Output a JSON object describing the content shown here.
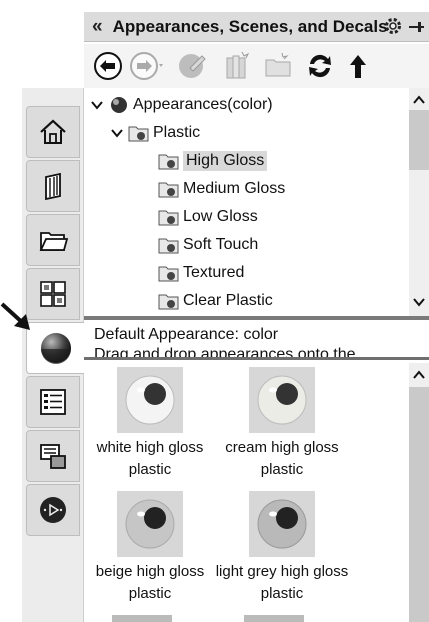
{
  "header": {
    "title": "Appearances, Scenes, and Decals"
  },
  "tree": {
    "root_label": "Appearances(color)",
    "category_label": "Plastic",
    "items": [
      {
        "label": "High Gloss",
        "selected": true
      },
      {
        "label": "Medium Gloss",
        "selected": false
      },
      {
        "label": "Low Gloss",
        "selected": false
      },
      {
        "label": "Soft Touch",
        "selected": false
      },
      {
        "label": "Textured",
        "selected": false
      },
      {
        "label": "Clear Plastic",
        "selected": false
      }
    ]
  },
  "info": {
    "line1": "Default Appearance: color",
    "line2": "Drag and drop appearances onto the"
  },
  "thumbnails": [
    {
      "label": "white high gloss plastic",
      "color": "#f2f2f2"
    },
    {
      "label": "cream high gloss plastic",
      "color": "#e8e8e2"
    },
    {
      "label": "beige high gloss plastic",
      "color": "#c4c4c4"
    },
    {
      "label": "light grey high gloss plastic",
      "color": "#b8b8b8"
    }
  ],
  "rail_tabs": [
    "home-icon",
    "design-library-icon",
    "file-explorer-icon",
    "view-palette-icon",
    "appearances-icon",
    "custom-properties-icon",
    "solidworks-forum-icon",
    "media-player-icon"
  ]
}
